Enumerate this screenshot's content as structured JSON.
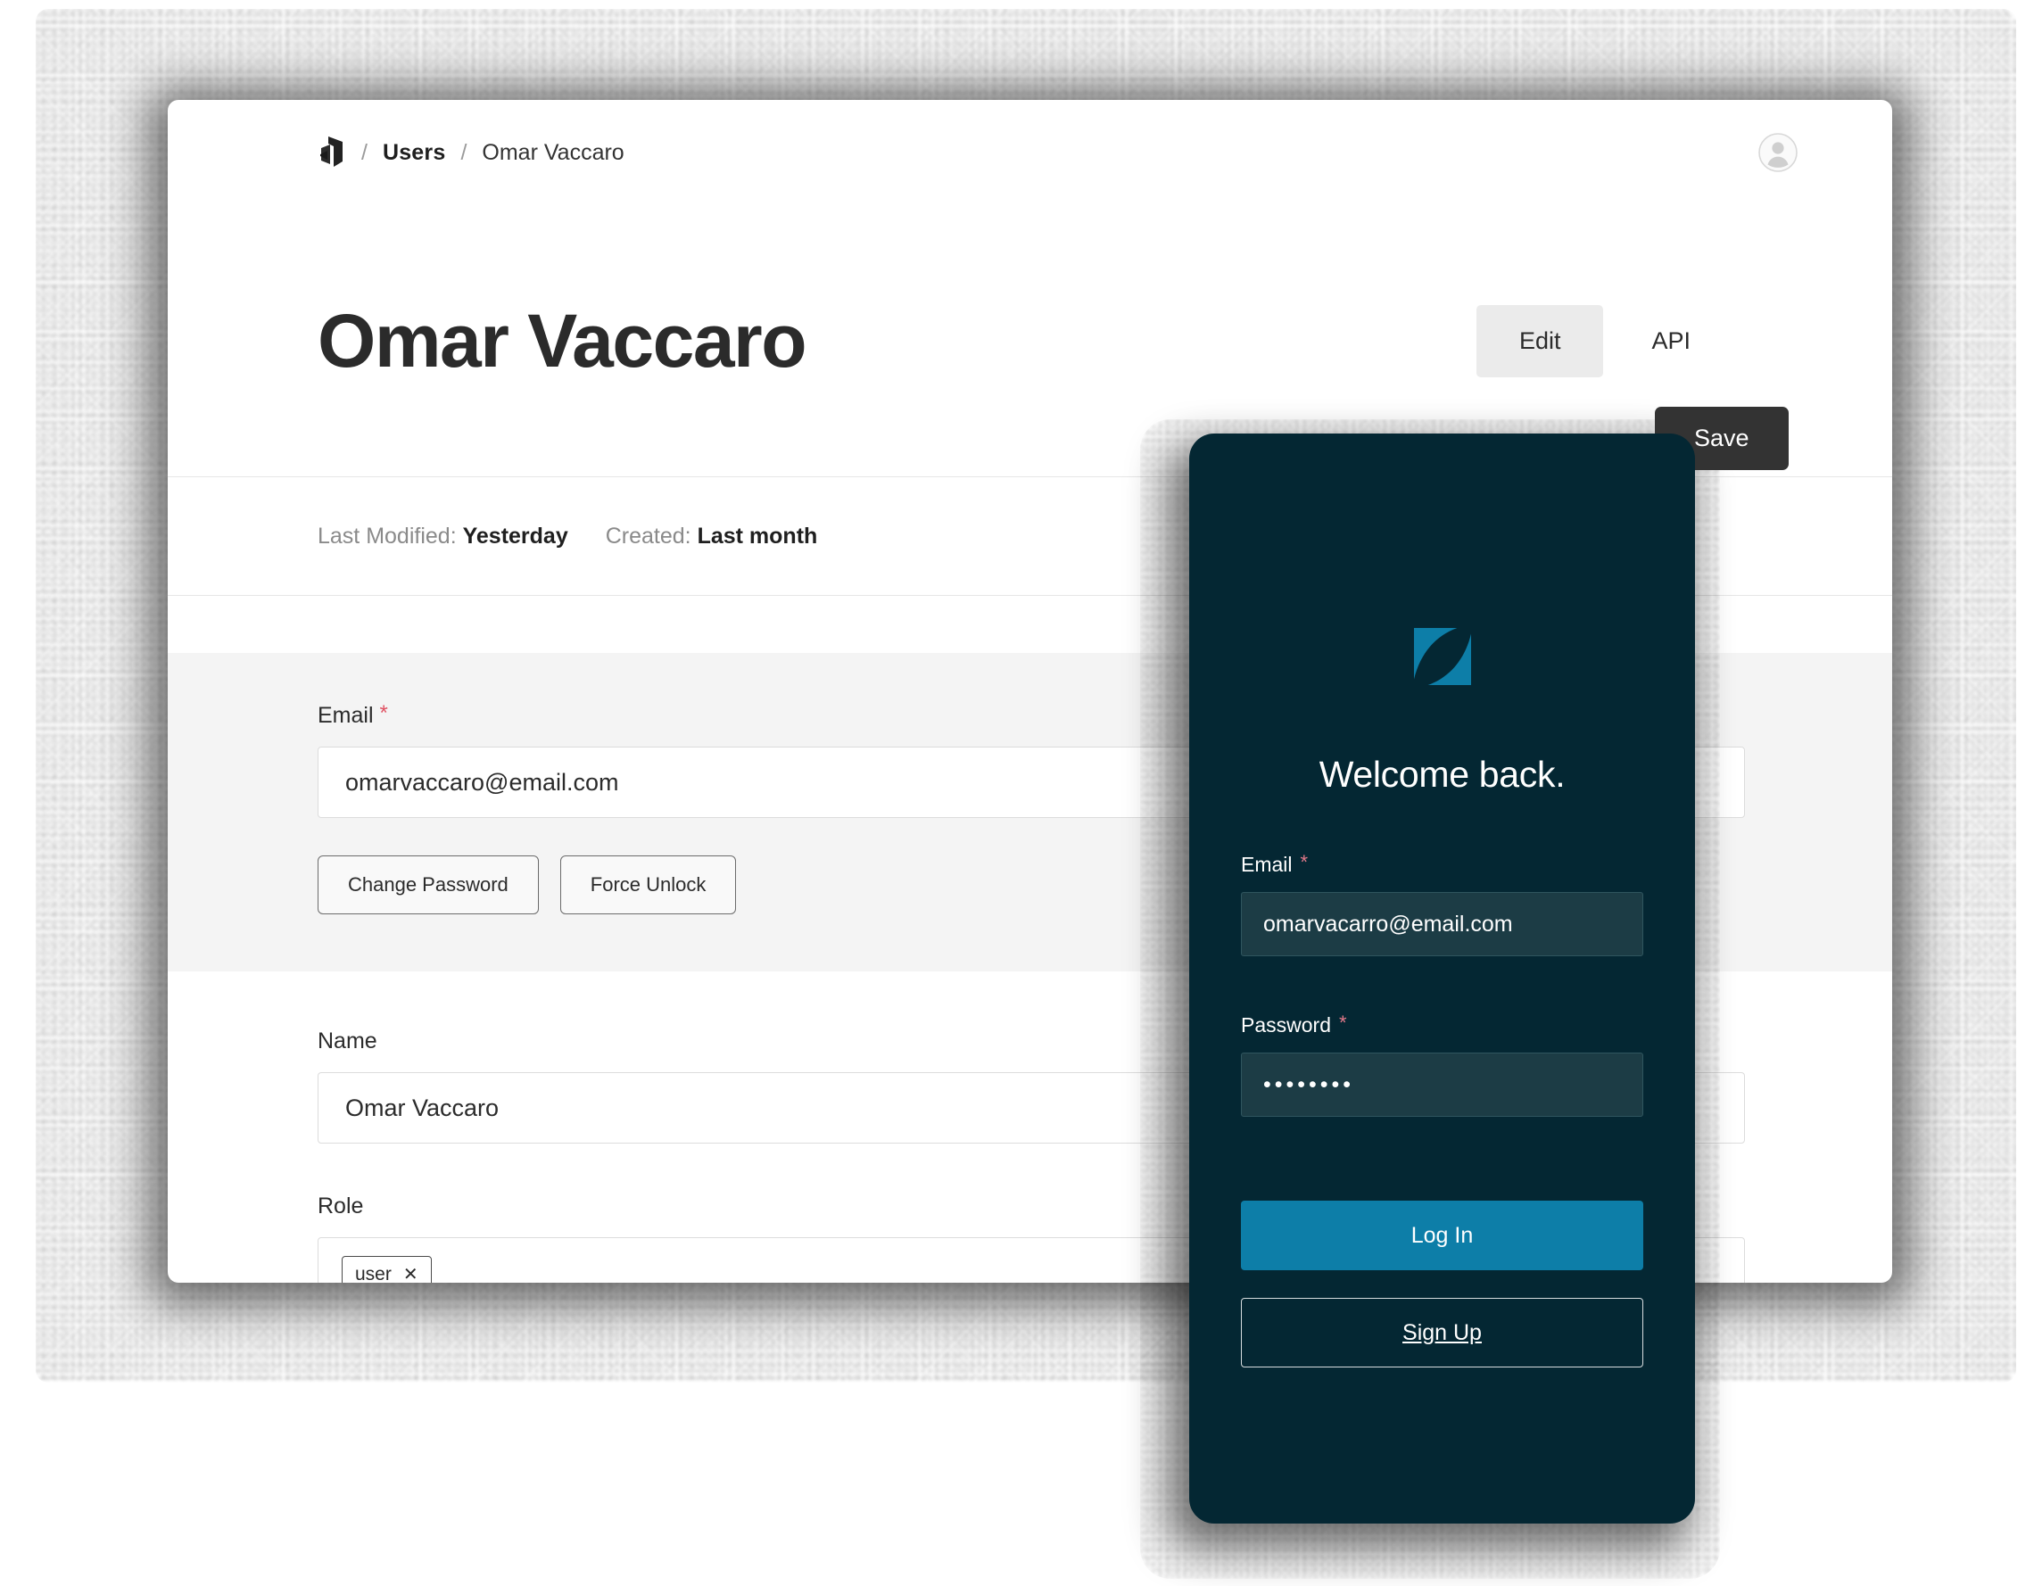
{
  "desktop": {
    "breadcrumb": {
      "logo_icon": "brand-arrow-icon",
      "separator": "/",
      "items": [
        {
          "label": "Users"
        },
        {
          "label": "Omar Vaccaro"
        }
      ]
    },
    "avatar_icon": "user-avatar-icon",
    "page_title": "Omar Vaccaro",
    "tabs": [
      {
        "label": "Edit",
        "active": true
      },
      {
        "label": "API",
        "active": false
      }
    ],
    "meta": [
      {
        "label": "Last Modified:",
        "value": "Yesterday"
      },
      {
        "label": "Created:",
        "value": "Last month"
      }
    ],
    "save_label": "Save",
    "form": {
      "email": {
        "label": "Email",
        "required_mark": "*",
        "value": "omarvaccaro@email.com"
      },
      "change_password_label": "Change Password",
      "force_unlock_label": "Force Unlock",
      "name": {
        "label": "Name",
        "value": "Omar Vaccaro"
      },
      "role": {
        "label": "Role",
        "chips": [
          {
            "label": "user",
            "remove_icon": "✕"
          }
        ]
      }
    }
  },
  "mobile": {
    "logo_icon": "brand-leaf-logo",
    "heading": "Welcome back.",
    "email": {
      "label": "Email",
      "required_mark": "*",
      "value": "omarvacarro@email.com"
    },
    "password": {
      "label": "Password",
      "required_mark": "*",
      "value": "••••••••"
    },
    "login_label": "Log In",
    "signup_label": "Sign Up"
  },
  "colors": {
    "brand_blue": "#0d7ea8",
    "panel_dark": "#042733",
    "save_dark": "#333333",
    "required_red": "#e05263",
    "panel_gray": "#f4f4f4"
  }
}
